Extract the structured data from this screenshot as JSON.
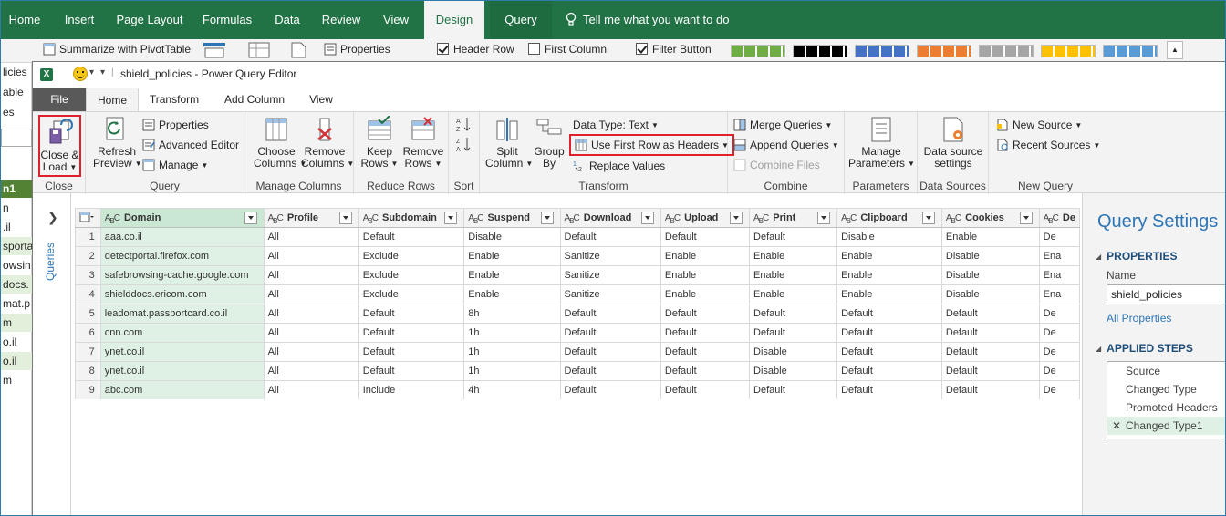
{
  "excel": {
    "tabs": [
      "Home",
      "Insert",
      "Page Layout",
      "Formulas",
      "Data",
      "Review",
      "View",
      "Design",
      "Query"
    ],
    "tell_me": "Tell me what you want to do",
    "ribbon": {
      "summarize": "Summarize with PivotTable",
      "properties": "Properties",
      "header_row": "Header Row",
      "first_column": "First Column",
      "filter_button": "Filter Button"
    },
    "sheet_cells": [
      "licies",
      "able",
      "es",
      "",
      "n1",
      "n",
      ".il",
      "sporta",
      "owsin",
      "docs.",
      "mat.p",
      "m",
      "o.il",
      "o.il",
      "m"
    ],
    "colors": {
      "accent": "#217346",
      "header_green": "#548235"
    }
  },
  "pq": {
    "title": "shield_policies - Power Query Editor",
    "tabs": [
      "File",
      "Home",
      "Transform",
      "Add Column",
      "View"
    ],
    "ribbon": {
      "close_load": "Close &\nLoad",
      "close_load_1": "Close &",
      "close_load_2": "Load",
      "refresh_1": "Refresh",
      "refresh_2": "Preview",
      "properties": "Properties",
      "advanced_editor": "Advanced Editor",
      "manage": "Manage",
      "choose_1": "Choose",
      "choose_2": "Columns",
      "remove_1": "Remove",
      "remove_2": "Columns",
      "keep_1": "Keep",
      "keep_2": "Rows",
      "remove_rows_1": "Remove",
      "remove_rows_2": "Rows",
      "split_1": "Split",
      "split_2": "Column",
      "group_1": "Group",
      "group_2": "By",
      "data_type": "Data Type: Text",
      "use_first_row": "Use First Row as Headers",
      "replace_values": "Replace Values",
      "merge_queries": "Merge Queries",
      "append_queries": "Append Queries",
      "combine_files": "Combine Files",
      "manage_params_1": "Manage",
      "manage_params_2": "Parameters",
      "datasource_1": "Data source",
      "datasource_2": "settings",
      "new_source": "New Source",
      "recent_sources": "Recent Sources",
      "groups": {
        "close": "Close",
        "query": "Query",
        "manage_columns": "Manage Columns",
        "reduce_rows": "Reduce Rows",
        "sort": "Sort",
        "transform": "Transform",
        "combine": "Combine",
        "parameters": "Parameters",
        "data_sources": "Data Sources",
        "new_query": "New Query"
      }
    },
    "queries_label": "Queries",
    "grid": {
      "columns": [
        "Domain",
        "Profile",
        "Subdomain",
        "Suspend",
        "Download",
        "Upload",
        "Print",
        "Clipboard",
        "Cookies",
        "De"
      ],
      "rows": [
        [
          "1",
          "aaa.co.il",
          "All",
          "Default",
          "Disable",
          "Default",
          "Default",
          "Default",
          "Disable",
          "Enable",
          "De"
        ],
        [
          "2",
          "detectportal.firefox.com",
          "All",
          "Exclude",
          "Enable",
          "Sanitize",
          "Enable",
          "Enable",
          "Enable",
          "Disable",
          "Ena"
        ],
        [
          "3",
          "safebrowsing-cache.google.com",
          "All",
          "Exclude",
          "Enable",
          "Sanitize",
          "Enable",
          "Enable",
          "Enable",
          "Disable",
          "Ena"
        ],
        [
          "4",
          "shielddocs.ericom.com",
          "All",
          "Exclude",
          "Enable",
          "Sanitize",
          "Enable",
          "Enable",
          "Enable",
          "Disable",
          "Ena"
        ],
        [
          "5",
          "leadomat.passportcard.co.il",
          "All",
          "Default",
          "8h",
          "Default",
          "Default",
          "Default",
          "Default",
          "Default",
          "De"
        ],
        [
          "6",
          "cnn.com",
          "All",
          "Default",
          "1h",
          "Default",
          "Default",
          "Default",
          "Default",
          "Default",
          "De"
        ],
        [
          "7",
          "ynet.co.il",
          "All",
          "Default",
          "1h",
          "Default",
          "Default",
          "Disable",
          "Default",
          "Default",
          "De"
        ],
        [
          "8",
          "ynet.co.il",
          "All",
          "Default",
          "1h",
          "Default",
          "Default",
          "Disable",
          "Default",
          "Default",
          "De"
        ],
        [
          "9",
          "abc.com",
          "All",
          "Include",
          "4h",
          "Default",
          "Default",
          "Default",
          "Default",
          "Default",
          "De"
        ]
      ]
    },
    "settings": {
      "title": "Query Settings",
      "properties": "PROPERTIES",
      "name_label": "Name",
      "name_value": "shield_policies",
      "all_properties": "All Properties",
      "applied_steps": "APPLIED STEPS",
      "steps": [
        "Source",
        "Changed Type",
        "Promoted Headers",
        "Changed Type1"
      ]
    }
  }
}
